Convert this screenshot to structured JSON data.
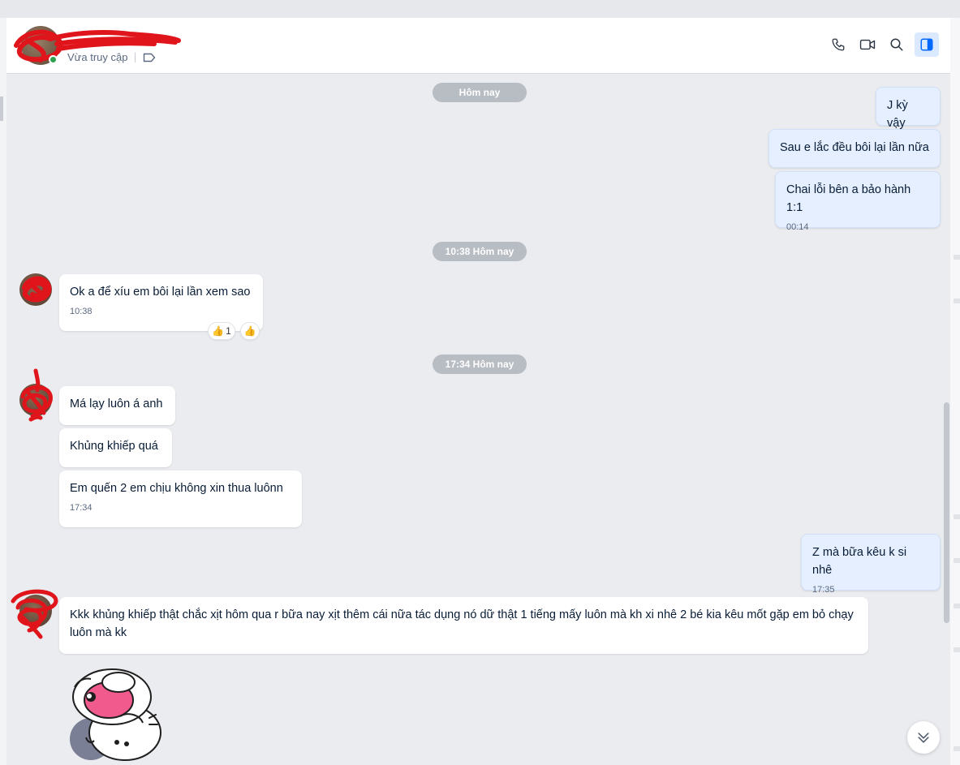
{
  "header": {
    "contact_name": "",
    "status": "Vừa truy cập"
  },
  "messages": {
    "date1": "Hôm nay",
    "out1": "J kỳ vậy",
    "out2": "Sau e lắc đều bôi lại lần nữa",
    "out3": "Chai lỗi bên a bảo hành 1:1",
    "out3_time": "00:14",
    "date2": "10:38 Hôm nay",
    "in1": "Ok a để xíu em bôi lại lần xem sao",
    "in1_time": "10:38",
    "in1_reaction_count": "1",
    "date3": "17:34 Hôm nay",
    "in2": "Má lạy luôn á anh",
    "in3": "Khủng khiếp quá",
    "in4": "Em quến 2 em chịu không xin thua luônn",
    "in4_time": "17:34",
    "out4": "Z mà bữa kêu k si nhê",
    "out4_time": "17:35",
    "in5": "Kkk khủng khiếp thật chắc xịt hôm qua r bữa nay xịt thêm cái nữa tác dụng nó dữ thật 1 tiếng mấy luôn mà kh xi nhê 2 bé kia kêu mốt gặp em bỏ chạy luôn mà kk"
  },
  "icons": {
    "phone": "phone-icon",
    "video": "video-call-icon",
    "search": "search-icon",
    "sidebar": "sidebar-toggle-icon",
    "tag": "tag-icon",
    "reaction": "thumbs-up-emoji",
    "scroll": "chevrons-down-icon"
  },
  "colors": {
    "accent": "#0068ff",
    "outgoing_bubble": "#e5efff",
    "incoming_bubble": "#ffffff",
    "chat_background": "#ebecf0",
    "date_pill": "#b8bcc3",
    "online": "#30a14e",
    "redaction": "#e0141b"
  }
}
